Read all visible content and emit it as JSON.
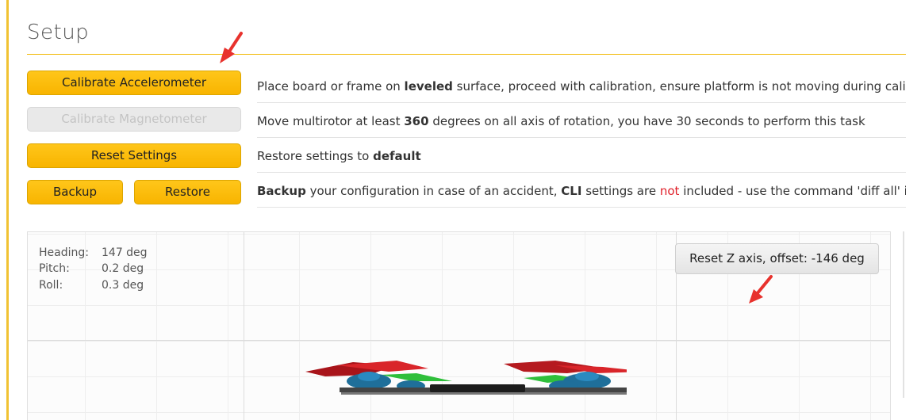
{
  "page": {
    "title": "Setup"
  },
  "buttons": {
    "calibrate_accel": "Calibrate Accelerometer",
    "calibrate_mag": "Calibrate Magnetometer",
    "reset_settings": "Reset Settings",
    "backup": "Backup",
    "restore": "Restore"
  },
  "descriptions": {
    "accel": {
      "pre": "Place board or frame on ",
      "bold": "leveled",
      "post": " surface, proceed with calibration, ensure platform is not moving during calibra"
    },
    "mag": {
      "pre": "Move multirotor at least ",
      "bold": "360",
      "post": " degrees on all axis of rotation, you have 30 seconds to perform this task"
    },
    "reset": {
      "pre": "Restore settings to ",
      "bold": "default"
    },
    "backup": {
      "bold1": "Backup",
      "mid1": " your configuration in case of an accident, ",
      "bold2": "CLI",
      "mid2": " settings are ",
      "red": "not",
      "post": " included - use the command 'diff all' in CL"
    }
  },
  "attitude": {
    "heading_label": "Heading:",
    "heading_value": "147 deg",
    "pitch_label": "Pitch:",
    "pitch_value": "0.2 deg",
    "roll_label": "Roll:",
    "roll_value": "0.3 deg"
  },
  "reset_z": {
    "label": "Reset Z axis, offset: -146 deg"
  },
  "colors": {
    "accent": "#f8b400",
    "annotation_arrow": "#e8322d",
    "red_text": "#e0202a"
  }
}
